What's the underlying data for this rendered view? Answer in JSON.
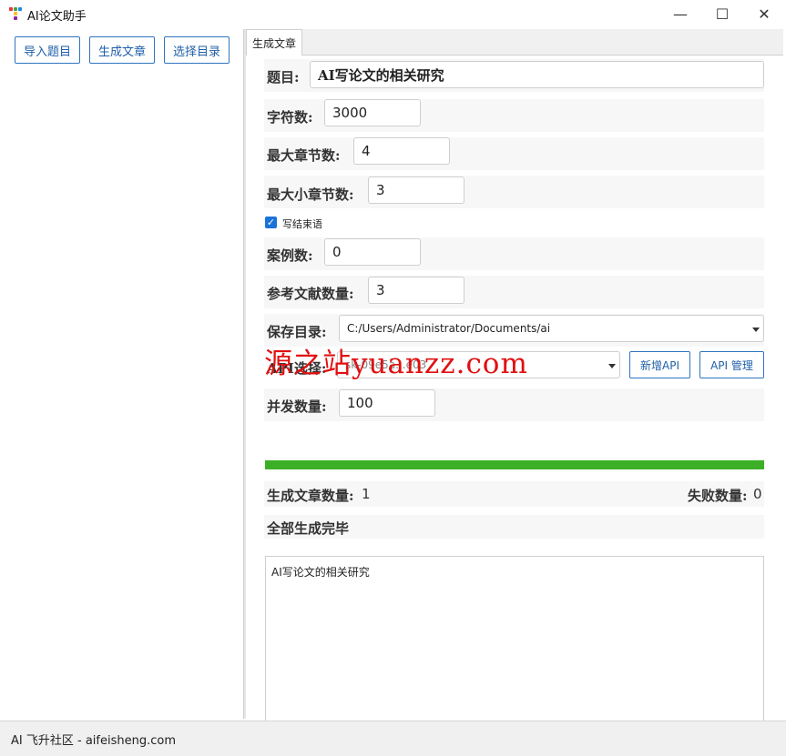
{
  "window": {
    "title": "AI论文助手",
    "controls": {
      "minimize": "—",
      "maximize": "☐",
      "close": "✕"
    },
    "logo_colors": [
      "#e53935",
      "#43a047",
      "#1e88e5",
      "#fbc02d",
      "#8e24aa"
    ]
  },
  "sidebar": {
    "buttons": [
      {
        "label": "导入题目"
      },
      {
        "label": "生成文章"
      },
      {
        "label": "选择目录"
      }
    ]
  },
  "tabs": [
    {
      "label": "生成文章",
      "active": true
    }
  ],
  "form": {
    "title_label": "题目:",
    "title_value": "AI写论文的相关研究",
    "chars_label": "字符数:",
    "chars_value": "3000",
    "max_chapters_label": "最大章节数:",
    "max_chapters_value": "4",
    "max_subchapters_label": "最大小章节数:",
    "max_subchapters_value": "3",
    "conclusion_checkbox": {
      "label": "写结束语",
      "checked": true,
      "mark": "✓"
    },
    "cases_label": "案例数:",
    "cases_value": "0",
    "refs_label": "参考文献数量:",
    "refs_value": "3",
    "save_dir_label": "保存目录:",
    "save_dir_value": "C:/Users/Administrator/Documents/ai",
    "api_label": "API选择:",
    "api_value": "sk-09e5a...e03",
    "add_api_label": "新增API",
    "manage_api_label": "API 管理",
    "concurrency_label": "并发数量:",
    "concurrency_value": "100"
  },
  "progress": {
    "percent": 100,
    "color": "#3caf26"
  },
  "stats": {
    "generated_label": "生成文章数量:",
    "generated_value": "1",
    "failed_label": "失败数量:",
    "failed_value": "0",
    "status_message": "全部生成完毕"
  },
  "log": {
    "text": "AI写论文的相关研究"
  },
  "statusbar": {
    "text": "AI 飞升社区 - aifeisheng.com"
  },
  "watermark": {
    "text": "源之站yuanzz.com",
    "color": "#e01010"
  }
}
